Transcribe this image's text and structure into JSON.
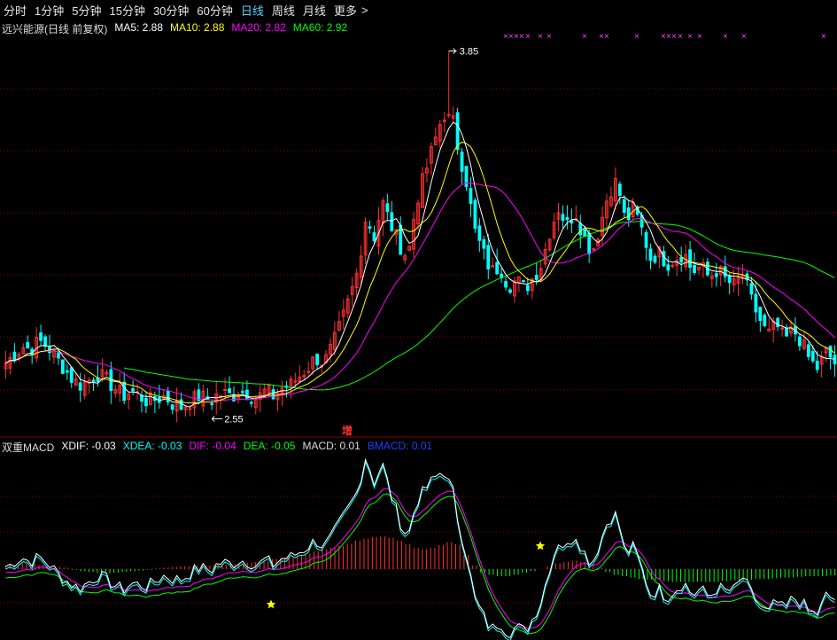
{
  "tabs": {
    "fenshi": "分时",
    "m1": "1分钟",
    "m5": "5分钟",
    "m15": "15分钟",
    "m30": "30分钟",
    "m60": "60分钟",
    "daily": "日线",
    "weekly": "周线",
    "monthly": "月线",
    "more": "更多",
    "more_caret": ">"
  },
  "main_legend": {
    "title": "远兴能源(日线 前复权)",
    "ma5": "MA5: 2.88",
    "ma10": "MA10: 2.88",
    "ma20": "MA20: 2.82",
    "ma60": "MA60: 2.92"
  },
  "macd_legend": {
    "title": "双重MACD",
    "xdif": "XDIF: -0.03",
    "xdea": "XDEA: -0.03",
    "dif": "DIF: -0.04",
    "dea": "DEA: -0.05",
    "macd": "MACD: 0.01",
    "bmacd": "BMACD: 0.01"
  },
  "annotations": {
    "high_label": "3.85",
    "low_label": "2.55",
    "marker": "增",
    "x_mark": "×"
  },
  "colors": {
    "up": "#ff3030",
    "down": "#00ffff",
    "ma5": "#ffffff",
    "ma10": "#ffff00",
    "ma20": "#ff00ff",
    "ma60": "#00ff00",
    "xdif": "#ffffff",
    "xdea": "#00ffff",
    "dif": "#ff00ff",
    "dea": "#00ff00",
    "bmacd": "#2040ff",
    "grid": "#8b0000"
  },
  "chart_data": {
    "type": "candlestick",
    "price_range": [
      2.5,
      3.9
    ],
    "high_close": [
      2.72,
      2.75,
      2.78,
      2.77,
      2.8,
      2.78,
      2.74,
      2.7,
      2.66,
      2.64,
      2.66,
      2.68,
      2.66,
      2.63,
      2.6,
      2.62,
      2.6,
      2.58,
      2.59,
      2.6,
      2.57,
      2.56,
      2.58,
      2.6,
      2.59,
      2.6,
      2.61,
      2.6,
      2.62,
      2.61,
      2.59,
      2.62,
      2.6,
      2.63,
      2.64,
      2.67,
      2.7,
      2.74,
      2.72,
      2.78,
      2.86,
      2.95,
      3.05,
      3.25,
      3.18,
      3.3,
      3.22,
      3.15,
      3.1,
      3.3,
      3.4,
      3.5,
      3.6,
      3.66,
      3.5,
      3.38,
      3.2,
      3.12,
      3.05,
      3.07,
      3.0,
      3.02,
      2.99,
      3.03,
      3.08,
      3.2,
      3.28,
      3.22,
      3.27,
      3.18,
      3.12,
      3.22,
      3.34,
      3.38,
      3.23,
      3.28,
      3.2,
      3.1,
      3.12,
      3.08,
      3.1,
      3.12,
      3.05,
      3.07,
      3.03,
      3.06,
      3.02,
      3.0,
      3.04,
      2.95,
      2.88,
      2.82,
      2.86,
      2.8,
      2.84,
      2.8,
      2.73,
      2.7,
      2.76,
      2.72
    ],
    "low_close": 2.55,
    "peak_close": 3.85,
    "macd_bars": [
      0.005,
      0.006,
      0.008,
      0.007,
      0.006,
      0.004,
      0.003,
      0.002,
      -0.001,
      -0.003,
      -0.004,
      -0.005,
      -0.006,
      -0.005,
      -0.004,
      -0.003,
      -0.002,
      -0.001,
      0.001,
      0.002,
      0.003,
      0.004,
      0.004,
      0.005,
      0.005,
      0.006,
      0.006,
      0.007,
      0.008,
      0.009,
      0.01,
      0.012,
      0.014,
      0.016,
      0.018,
      0.02,
      0.022,
      0.025,
      0.028,
      0.03,
      0.033,
      0.036,
      0.04,
      0.043,
      0.045,
      0.046,
      0.044,
      0.04,
      0.035,
      0.03,
      0.028,
      0.03,
      0.034,
      0.038,
      0.035,
      0.02,
      0.005,
      -0.005,
      -0.008,
      -0.01,
      -0.01,
      -0.008,
      -0.005,
      -0.003,
      0.0,
      0.004,
      0.008,
      0.01,
      0.012,
      0.01,
      0.006,
      0.002,
      -0.004,
      -0.008,
      -0.01,
      -0.012,
      -0.014,
      -0.015,
      -0.016,
      -0.017,
      -0.018,
      -0.018,
      -0.018,
      -0.018,
      -0.018,
      -0.018,
      -0.017,
      -0.016,
      -0.016,
      -0.015,
      -0.014,
      -0.014,
      -0.013,
      -0.012,
      -0.012,
      -0.011,
      -0.01,
      -0.01,
      -0.01,
      -0.009
    ]
  }
}
